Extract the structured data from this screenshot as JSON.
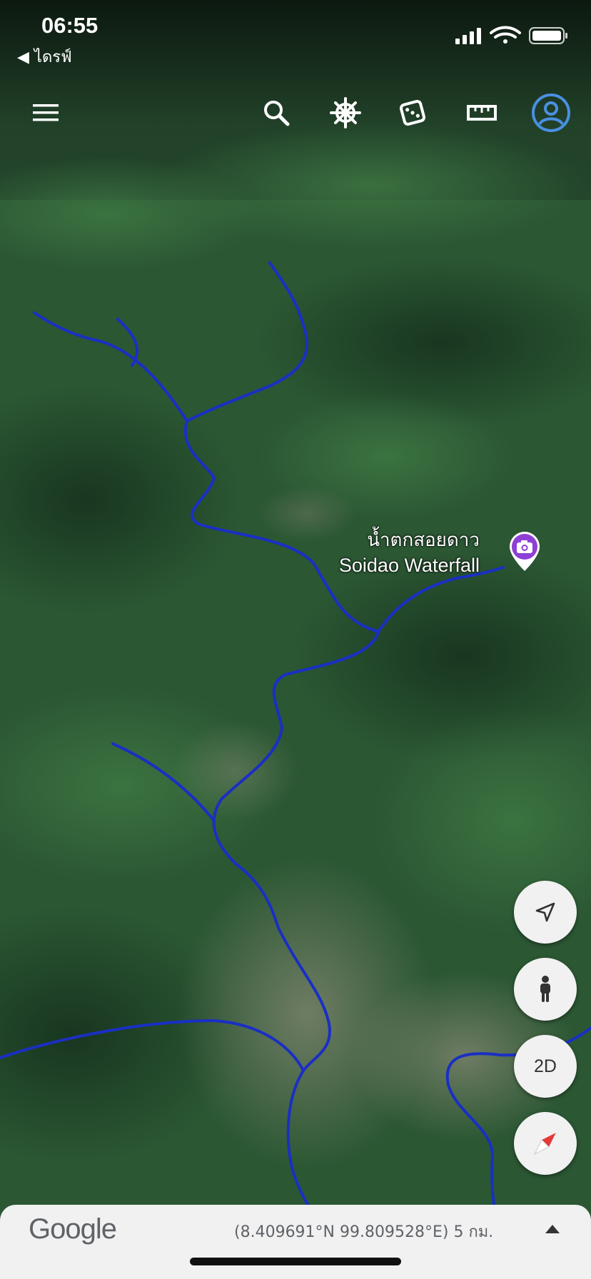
{
  "status_bar": {
    "time": "06:55",
    "back_label": "◀ ไดรฟ์"
  },
  "toolbar": {
    "menu_icon": "hamburger-menu-icon",
    "search_icon": "search-icon",
    "voyager_icon": "ship-wheel-icon",
    "feeling_lucky_icon": "dice-icon",
    "measure_icon": "ruler-icon",
    "account_icon": "account-icon",
    "account_color": "#4a90e2"
  },
  "place": {
    "name_thai": "น้ำตกสอยดาว",
    "name_english": "Soidao Waterfall",
    "pin_color": "#8e3fd6"
  },
  "map_controls": {
    "location_icon": "location-arrow-icon",
    "street_view_icon": "pegman-icon",
    "toggle_2d_label": "2D",
    "compass_icon": "compass-icon",
    "compass_color": "#e53935"
  },
  "bottom_bar": {
    "logo": "Google",
    "coordinates": "(8.409691°N 99.809528°E) 5 กม.",
    "expand_icon": "chevron-up-icon"
  },
  "colors": {
    "river": "#1a2fc4",
    "terrain": "#2a5a35"
  }
}
